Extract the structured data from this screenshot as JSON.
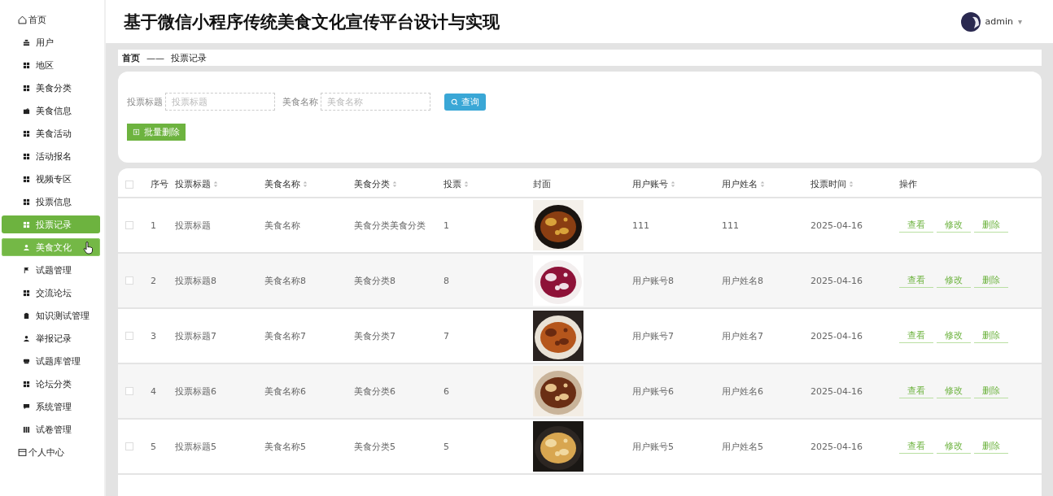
{
  "header": {
    "title": "基于微信小程序传统美食文化宣传平台设计与实现",
    "user": {
      "name": "admin",
      "caret": "▾"
    }
  },
  "sidebar": {
    "items": [
      {
        "label": "首页",
        "kind": "home",
        "selected": false,
        "hovered": false
      },
      {
        "label": "用户",
        "kind": "stack",
        "selected": false,
        "hovered": false
      },
      {
        "label": "地区",
        "kind": "grid",
        "selected": false,
        "hovered": false
      },
      {
        "label": "美食分类",
        "kind": "grid",
        "selected": false,
        "hovered": false
      },
      {
        "label": "美食信息",
        "kind": "wallet",
        "selected": false,
        "hovered": false
      },
      {
        "label": "美食活动",
        "kind": "grid",
        "selected": false,
        "hovered": false
      },
      {
        "label": "活动报名",
        "kind": "grid",
        "selected": false,
        "hovered": false
      },
      {
        "label": "视频专区",
        "kind": "grid",
        "selected": false,
        "hovered": false
      },
      {
        "label": "投票信息",
        "kind": "grid",
        "selected": false,
        "hovered": false
      },
      {
        "label": "投票记录",
        "kind": "grid",
        "selected": true,
        "hovered": false
      },
      {
        "label": "美食文化",
        "kind": "user",
        "selected": false,
        "hovered": true
      },
      {
        "label": "试题管理",
        "kind": "flag",
        "selected": false,
        "hovered": false
      },
      {
        "label": "交流论坛",
        "kind": "grid",
        "selected": false,
        "hovered": false
      },
      {
        "label": "知识测试管理",
        "kind": "clipboard",
        "selected": false,
        "hovered": false
      },
      {
        "label": "举报记录",
        "kind": "user",
        "selected": false,
        "hovered": false
      },
      {
        "label": "试题库管理",
        "kind": "box",
        "selected": false,
        "hovered": false
      },
      {
        "label": "论坛分类",
        "kind": "grid",
        "selected": false,
        "hovered": false
      },
      {
        "label": "系统管理",
        "kind": "chat",
        "selected": false,
        "hovered": false
      },
      {
        "label": "试卷管理",
        "kind": "book",
        "selected": false,
        "hovered": false
      },
      {
        "label": "个人中心",
        "kind": "window",
        "selected": false,
        "hovered": false
      }
    ]
  },
  "breadcrumb": {
    "home": "首页",
    "separator": "——",
    "current": "投票记录"
  },
  "search": {
    "fields": [
      {
        "label": "投票标题",
        "placeholder": "投票标题"
      },
      {
        "label": "美食名称",
        "placeholder": "美食名称"
      }
    ],
    "query_button": "查询",
    "batch_delete_button": "批量删除"
  },
  "table": {
    "select_all_checked": false,
    "columns": [
      {
        "label": "序号",
        "sortable": false
      },
      {
        "label": "投票标题",
        "sortable": true
      },
      {
        "label": "美食名称",
        "sortable": true
      },
      {
        "label": "美食分类",
        "sortable": true
      },
      {
        "label": "投票",
        "sortable": true
      },
      {
        "label": "封面",
        "sortable": false
      },
      {
        "label": "用户账号",
        "sortable": true
      },
      {
        "label": "用户姓名",
        "sortable": true
      },
      {
        "label": "投票时间",
        "sortable": true
      },
      {
        "label": "操作",
        "sortable": false
      }
    ],
    "rows": [
      {
        "checked": false,
        "cells": [
          "1",
          "投票标题",
          "美食名称",
          "美食分类美食分类",
          "1"
        ],
        "cells2": [
          "111",
          "111",
          "2025-04-16"
        ],
        "actions": [
          "查看",
          "修改",
          "删除"
        ]
      },
      {
        "checked": false,
        "cells": [
          "2",
          "投票标题8",
          "美食名称8",
          "美食分类8",
          "8"
        ],
        "cells2": [
          "用户账号8",
          "用户姓名8",
          "2025-04-16"
        ],
        "actions": [
          "查看",
          "修改",
          "删除"
        ]
      },
      {
        "checked": false,
        "cells": [
          "3",
          "投票标题7",
          "美食名称7",
          "美食分类7",
          "7"
        ],
        "cells2": [
          "用户账号7",
          "用户姓名7",
          "2025-04-16"
        ],
        "actions": [
          "查看",
          "修改",
          "删除"
        ]
      },
      {
        "checked": false,
        "cells": [
          "4",
          "投票标题6",
          "美食名称6",
          "美食分类6",
          "6"
        ],
        "cells2": [
          "用户账号6",
          "用户姓名6",
          "2025-04-16"
        ],
        "actions": [
          "查看",
          "修改",
          "删除"
        ]
      },
      {
        "checked": false,
        "cells": [
          "5",
          "投票标题5",
          "美食名称5",
          "美食分类5",
          "5"
        ],
        "cells2": [
          "用户账号5",
          "用户姓名5",
          "2025-04-16"
        ],
        "actions": [
          "查看",
          "修改",
          "删除"
        ]
      }
    ]
  }
}
